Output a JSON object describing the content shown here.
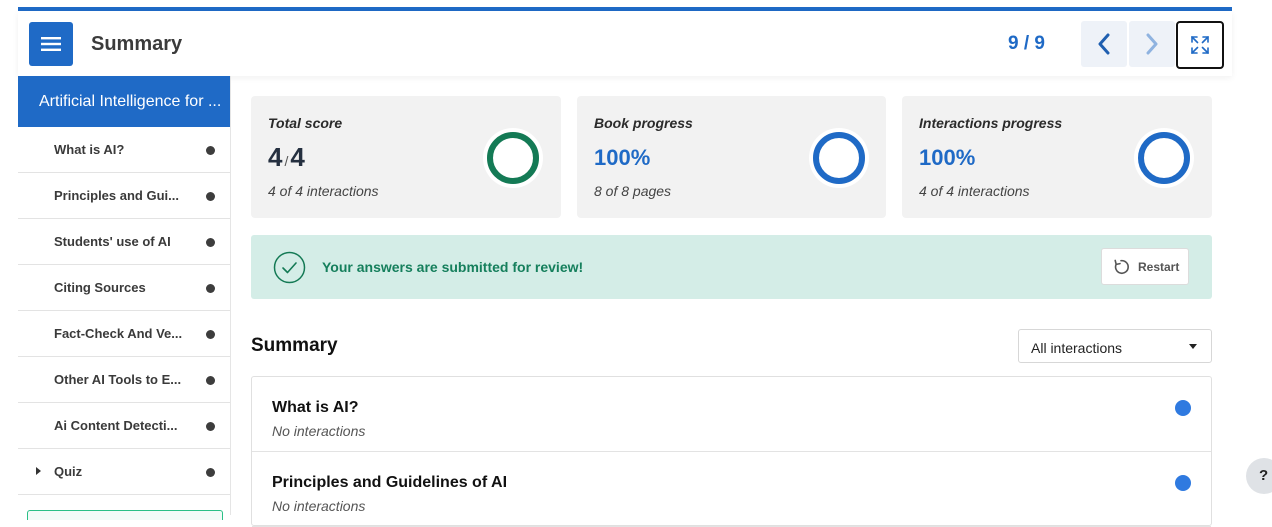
{
  "header": {
    "title": "Summary",
    "page_counter": "9 / 9",
    "menu_icon": "hamburger-icon",
    "prev_icon": "chevron-left-icon",
    "next_icon": "chevron-right-icon",
    "fullscreen_icon": "fullscreen-icon"
  },
  "sidebar": {
    "title": "Artificial Intelligence for ...",
    "items": [
      {
        "label": "What is AI?"
      },
      {
        "label": "Principles and Gui..."
      },
      {
        "label": "Students' use of AI"
      },
      {
        "label": "Citing Sources"
      },
      {
        "label": "Fact-Check And Ve..."
      },
      {
        "label": "Other AI Tools to E..."
      },
      {
        "label": "Ai Content Detecti..."
      },
      {
        "label": "Quiz"
      }
    ]
  },
  "cards": {
    "score": {
      "title": "Total score",
      "value": "4",
      "separator": "/",
      "max": "4",
      "sub": "4 of 4 interactions",
      "fraction": 1.0,
      "color": "#147a55"
    },
    "book": {
      "title": "Book progress",
      "value": "100%",
      "sub": "8 of 8 pages",
      "fraction": 1.0,
      "color": "#1f6ac6"
    },
    "interactions": {
      "title": "Interactions progress",
      "value": "100%",
      "sub": "4 of 4 interactions",
      "fraction": 1.0,
      "color": "#1f6ac6"
    }
  },
  "banner": {
    "message": "Your answers are submitted for review!",
    "restart_label": "Restart",
    "check_icon": "check-circle-icon",
    "restart_icon": "restart-icon"
  },
  "summary": {
    "heading": "Summary",
    "filter_value": "All interactions",
    "items": [
      {
        "title": "What is AI?",
        "sub": "No interactions"
      },
      {
        "title": "Principles and Guidelines of AI",
        "sub": "No interactions"
      }
    ]
  },
  "help": {
    "label": "?"
  },
  "colors": {
    "accent": "#1f6ac6",
    "success": "#147a55",
    "banner_bg": "#d4ede7"
  }
}
